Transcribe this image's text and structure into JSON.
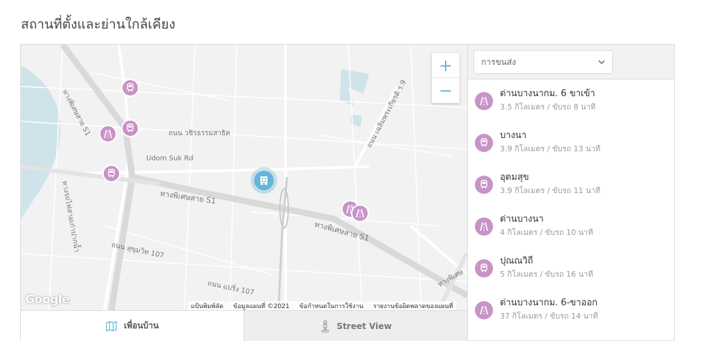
{
  "title": "สถานที่ตั้งและย่านใกล้เคียง",
  "map": {
    "zoom_in": "+",
    "zoom_out": "−",
    "google_logo": "Google",
    "attribution": {
      "shortcuts": "แป้นพิมพ์ลัด",
      "map_data": "ข้อมูลแผนที่ ©2021",
      "terms": "ข้อกำหนดในการใช้งาน",
      "report": "รายงานข้อผิดพลาดของแผนที่"
    },
    "road_labels": {
      "expressway_s1_a": "ทางพิเศษสาย S1",
      "expressway_s1_b": "ทางพิเศษสาย S1",
      "expressway_s1_c": "ทางพิเศษสาย S1",
      "expressway_s1_d": "ทางพิเศษ",
      "wachira": "ถนน วชิรธรรมสาธิต",
      "udom_suk": "Udom Suk Rd",
      "sukhumvit_107": "ถนน สุขุมวิท 107",
      "bearing_107": "ถนน แบริ่ง 107",
      "chaloem": "ถนน เฉลิมพระเกียรติ ร.9",
      "rail": "ทางรถไฟสายเก่าปากน้ำ"
    }
  },
  "tabs": {
    "neighborhood": "เพื่อนบ้าน",
    "street_view": "Street View"
  },
  "panel": {
    "dropdown_label": "การขนส่ง",
    "places": [
      {
        "name": "ด่านบางนากม. 6 ขาเข้า",
        "meta": "3.5 กิโลเมตร / ขับรถ 8 นาที",
        "icon": "toll-road-icon"
      },
      {
        "name": "บางนา",
        "meta": "3.9 กิโลเมตร / ขับรถ 13 นาที",
        "icon": "train-icon"
      },
      {
        "name": "อุดมสุข",
        "meta": "3.9 กิโลเมตร / ขับรถ 11 นาที",
        "icon": "train-icon"
      },
      {
        "name": "ด่านบางนา",
        "meta": "4 กิโลเมตร / ขับรถ 10 นาที",
        "icon": "toll-road-icon"
      },
      {
        "name": "ปุณณวิถี",
        "meta": "5 กิโลเมตร / ขับรถ 16 นาที",
        "icon": "train-icon"
      },
      {
        "name": "ด่านบางนากม. 6-ขาออก",
        "meta": "37 กิโลเมตร / ขับรถ 14 นาที",
        "icon": "toll-road-icon"
      }
    ]
  },
  "colors": {
    "accent": "#64b5d9",
    "pin": "#c893c6",
    "water": "#aadaff"
  }
}
